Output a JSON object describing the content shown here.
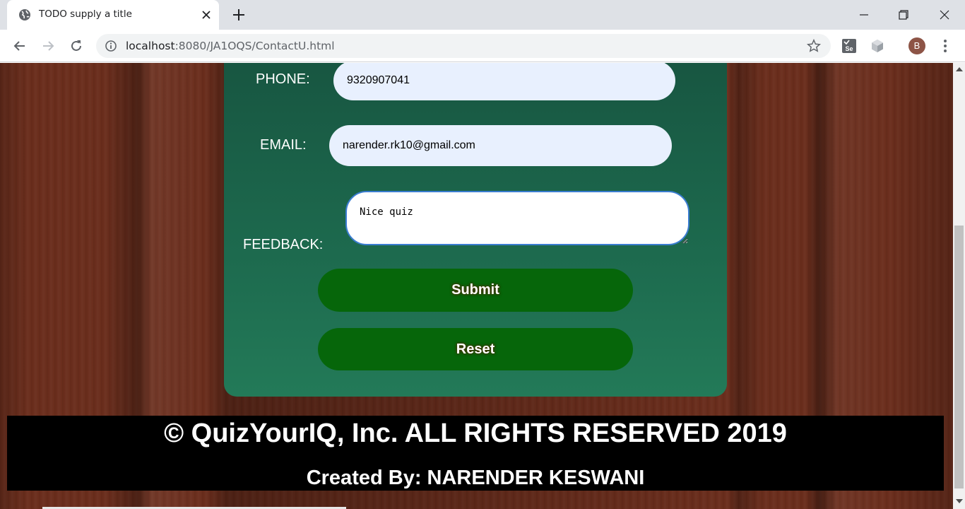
{
  "browser": {
    "tab_title": "TODO supply a title",
    "url_host": "localhost",
    "url_rest": ":8080/JA1OQS/ContactU.html",
    "profile_initial": "B",
    "icons": [
      "globe-icon",
      "close-icon",
      "plus-icon",
      "minimize-icon",
      "restore-icon",
      "window-close-icon",
      "back-icon",
      "forward-icon",
      "reload-icon",
      "info-icon",
      "star-icon",
      "selenium-ext-icon",
      "cube-ext-icon",
      "kebab-menu-icon"
    ]
  },
  "form": {
    "phone_label": "PHONE:",
    "phone_value": "9320907041",
    "email_label": "EMAIL:",
    "email_value": "narender.rk10@gmail.com",
    "feedback_label": "FEEDBACK:",
    "feedback_value": "Nice quiz",
    "submit_label": "Submit",
    "reset_label": "Reset"
  },
  "footer": {
    "copyright": "© QuizYourIQ, Inc. ALL RIGHTS RESERVED 2019",
    "credit": "Created By: NARENDER KESWANI"
  },
  "colors": {
    "card_top": "#175440",
    "card_bottom": "#237a58",
    "button": "#06660a",
    "input_bg": "#e8f0fe",
    "wood": "#6a2d1c"
  }
}
